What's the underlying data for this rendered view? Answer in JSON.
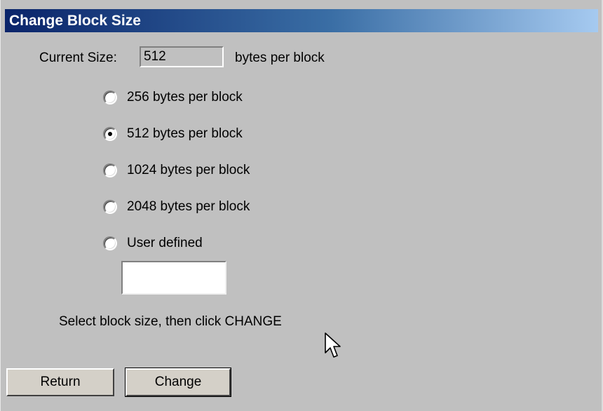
{
  "window": {
    "title": "Change Block Size"
  },
  "current_size": {
    "label": "Current Size:",
    "value": "512",
    "unit": "bytes per block"
  },
  "options": [
    {
      "label": "256 bytes per block",
      "checked": false
    },
    {
      "label": "512 bytes per block",
      "checked": true
    },
    {
      "label": "1024 bytes per block",
      "checked": false
    },
    {
      "label": "2048 bytes per block",
      "checked": false
    },
    {
      "label": "User defined",
      "checked": false
    }
  ],
  "user_defined_input": {
    "value": ""
  },
  "instruction": "Select block size, then click CHANGE",
  "buttons": {
    "return_label": "Return",
    "change_label": "Change"
  },
  "colors": {
    "window_bg": "#c0c0c0",
    "title_gradient_start": "#0a246a",
    "title_gradient_end": "#a6caf0"
  },
  "icons": {
    "cursor": "arrow-cursor-icon"
  }
}
